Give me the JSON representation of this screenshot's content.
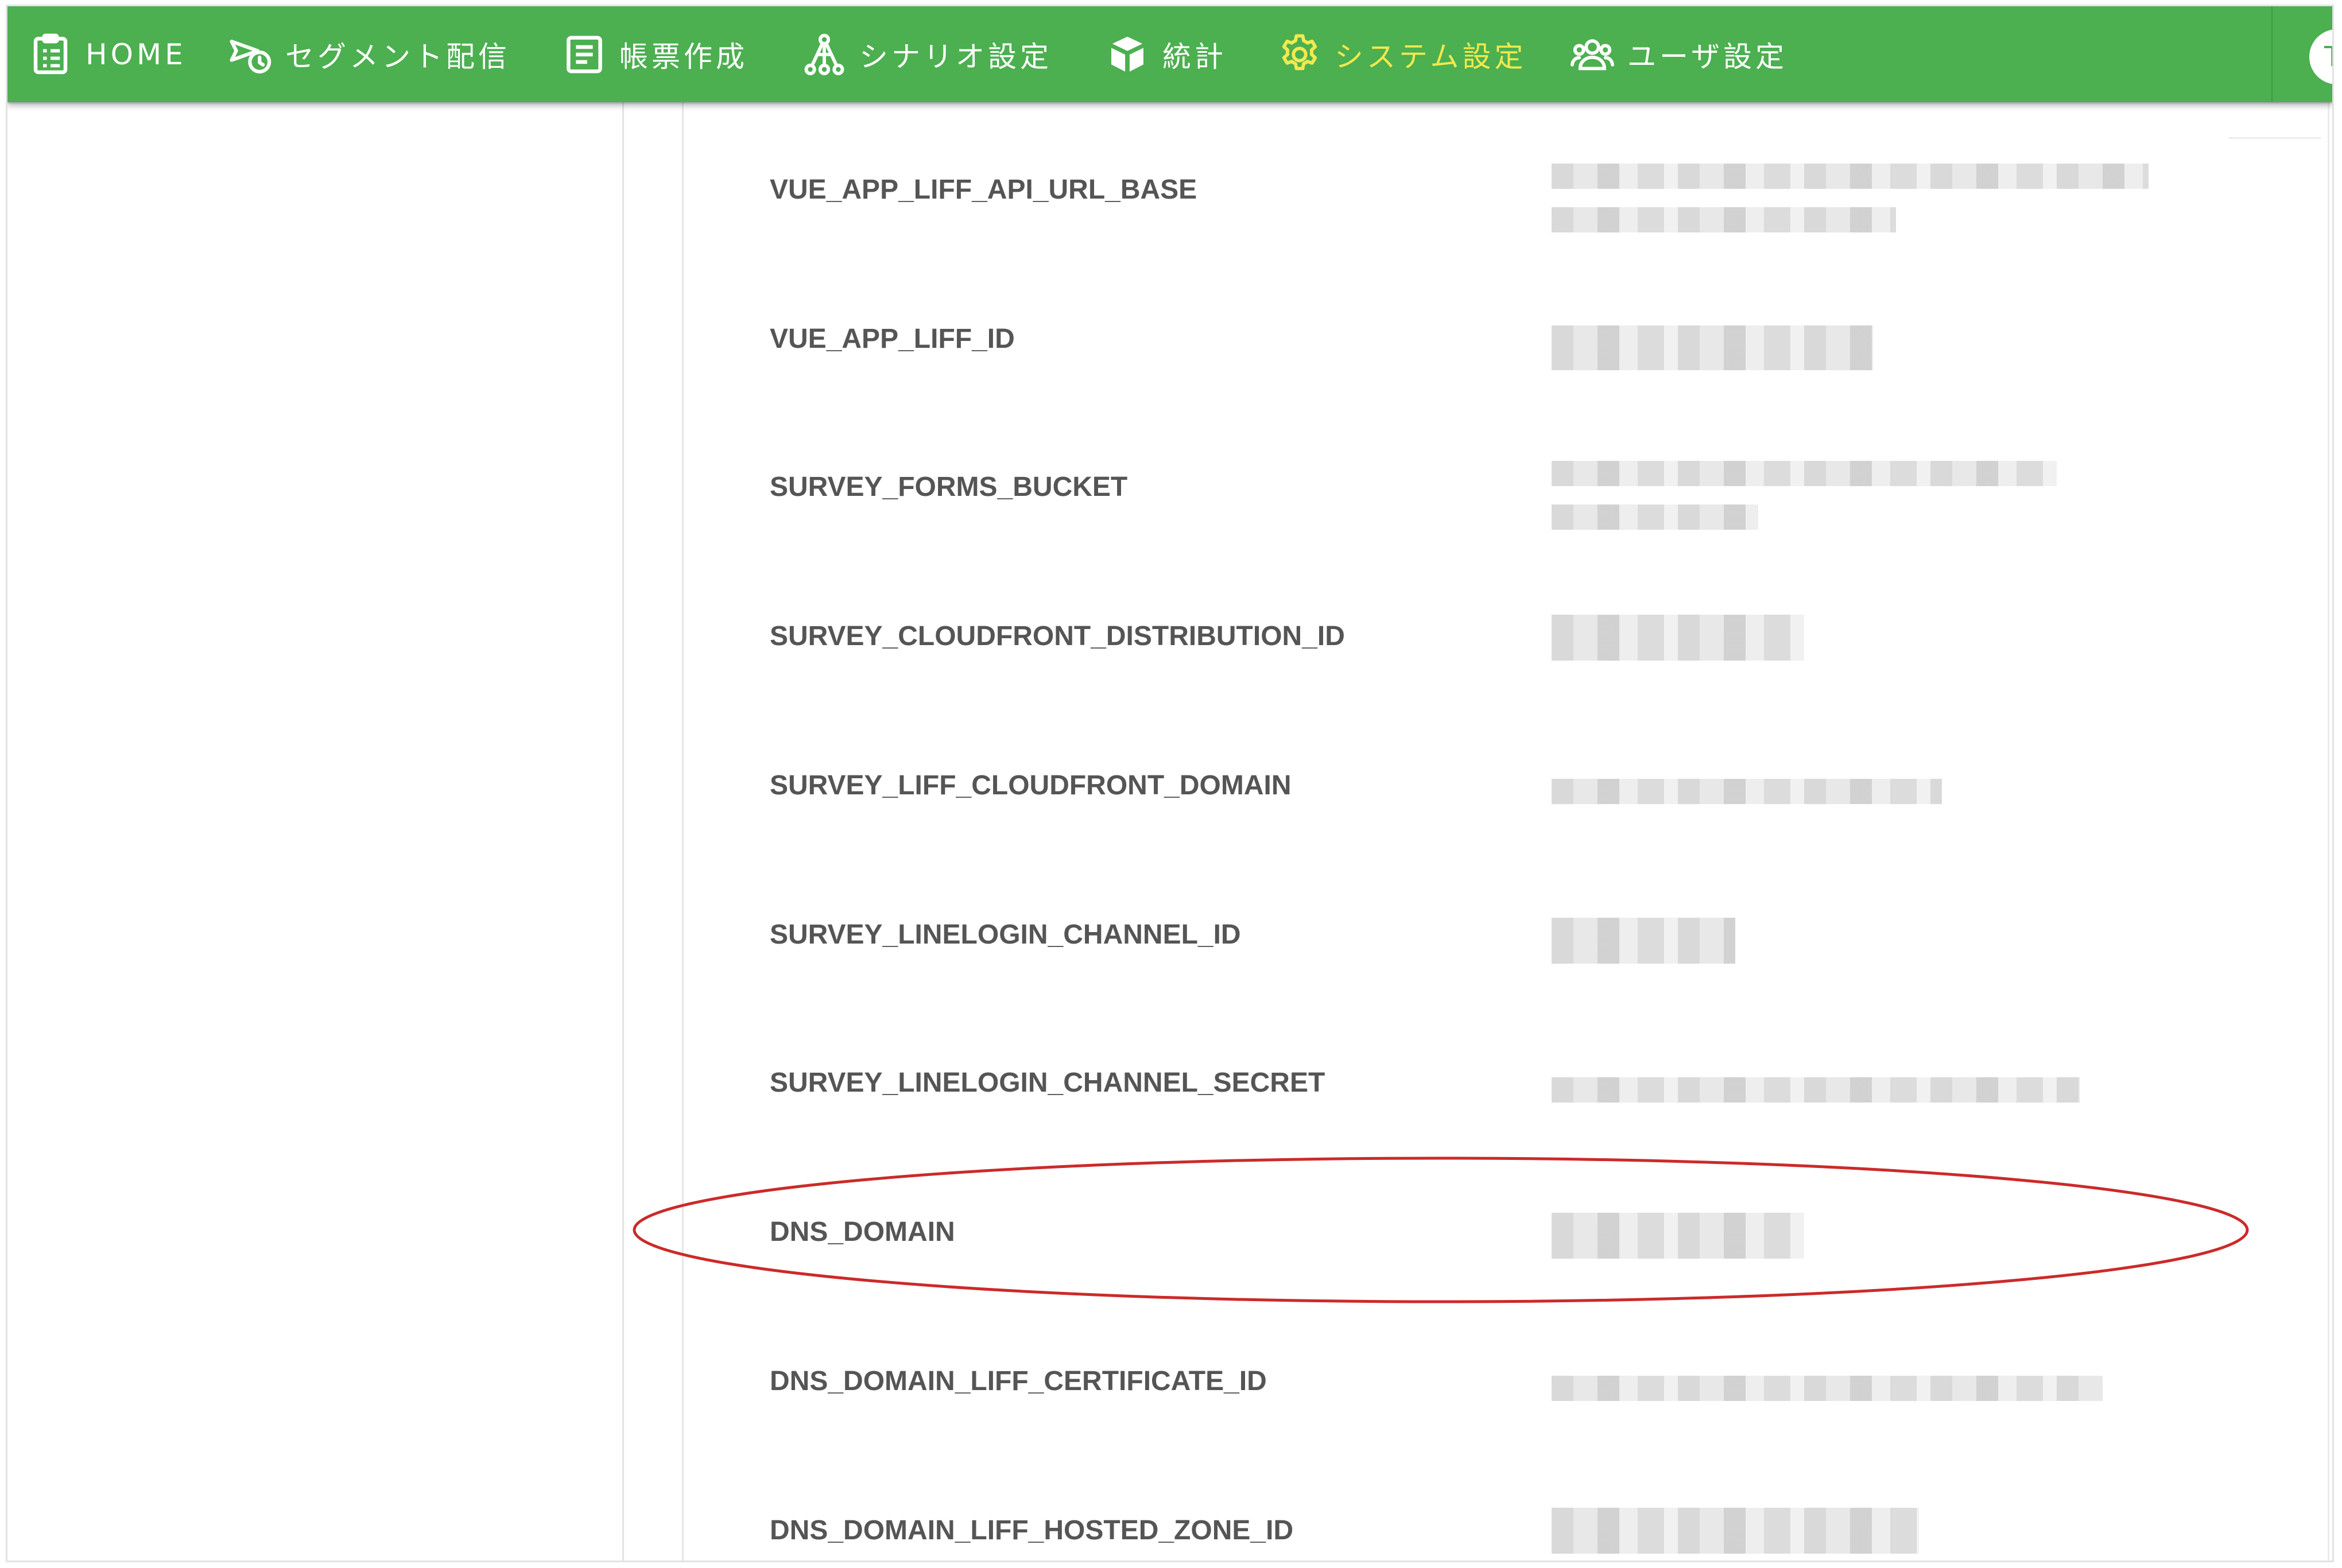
{
  "nav": {
    "items": [
      {
        "name": "nav-home",
        "icon": "clipboard-list-icon",
        "label": "HOME",
        "active": false
      },
      {
        "name": "nav-segment-delivery",
        "icon": "send-clock-icon",
        "label": "セグメント配信",
        "active": false
      },
      {
        "name": "nav-form-creation",
        "icon": "document-icon",
        "label": "帳票作成",
        "active": false
      },
      {
        "name": "nav-scenario-settings",
        "icon": "sitemap-icon",
        "label": "シナリオ設定",
        "active": false
      },
      {
        "name": "nav-statistics",
        "icon": "cube-icon",
        "label": "統計",
        "active": false
      },
      {
        "name": "nav-system-settings",
        "icon": "gear-icon",
        "label": "システム設定",
        "active": true
      },
      {
        "name": "nav-user-settings",
        "icon": "users-icon",
        "label": "ユーザ設定",
        "active": false
      }
    ],
    "avatar_initial": "T",
    "text_color": "#ffffff",
    "active_color": "#f2e94e",
    "bar_color": "#4caf50"
  },
  "settings": {
    "rows": [
      {
        "key": "VUE_APP_LIFF_API_URL_BASE",
        "value": "",
        "value_blurred": true
      },
      {
        "key": "VUE_APP_LIFF_ID",
        "value": "",
        "value_blurred": true
      },
      {
        "key": "SURVEY_FORMS_BUCKET",
        "value": "",
        "value_blurred": true
      },
      {
        "key": "SURVEY_CLOUDFRONT_DISTRIBUTION_ID",
        "value": "",
        "value_blurred": true
      },
      {
        "key": "SURVEY_LIFF_CLOUDFRONT_DOMAIN",
        "value": "",
        "value_blurred": true
      },
      {
        "key": "SURVEY_LINELOGIN_CHANNEL_ID",
        "value": "",
        "value_blurred": true
      },
      {
        "key": "SURVEY_LINELOGIN_CHANNEL_SECRET",
        "value": "",
        "value_blurred": true
      },
      {
        "key": "DNS_DOMAIN",
        "value": "",
        "value_blurred": true,
        "highlighted": true
      },
      {
        "key": "DNS_DOMAIN_LIFF_CERTIFICATE_ID",
        "value": "",
        "value_blurred": true
      },
      {
        "key": "DNS_DOMAIN_LIFF_HOSTED_ZONE_ID",
        "value": "",
        "value_blurred": true
      }
    ]
  },
  "annotation": {
    "highlight_color": "#cc2a2a",
    "shape": "ellipse",
    "target": "DNS_DOMAIN"
  }
}
